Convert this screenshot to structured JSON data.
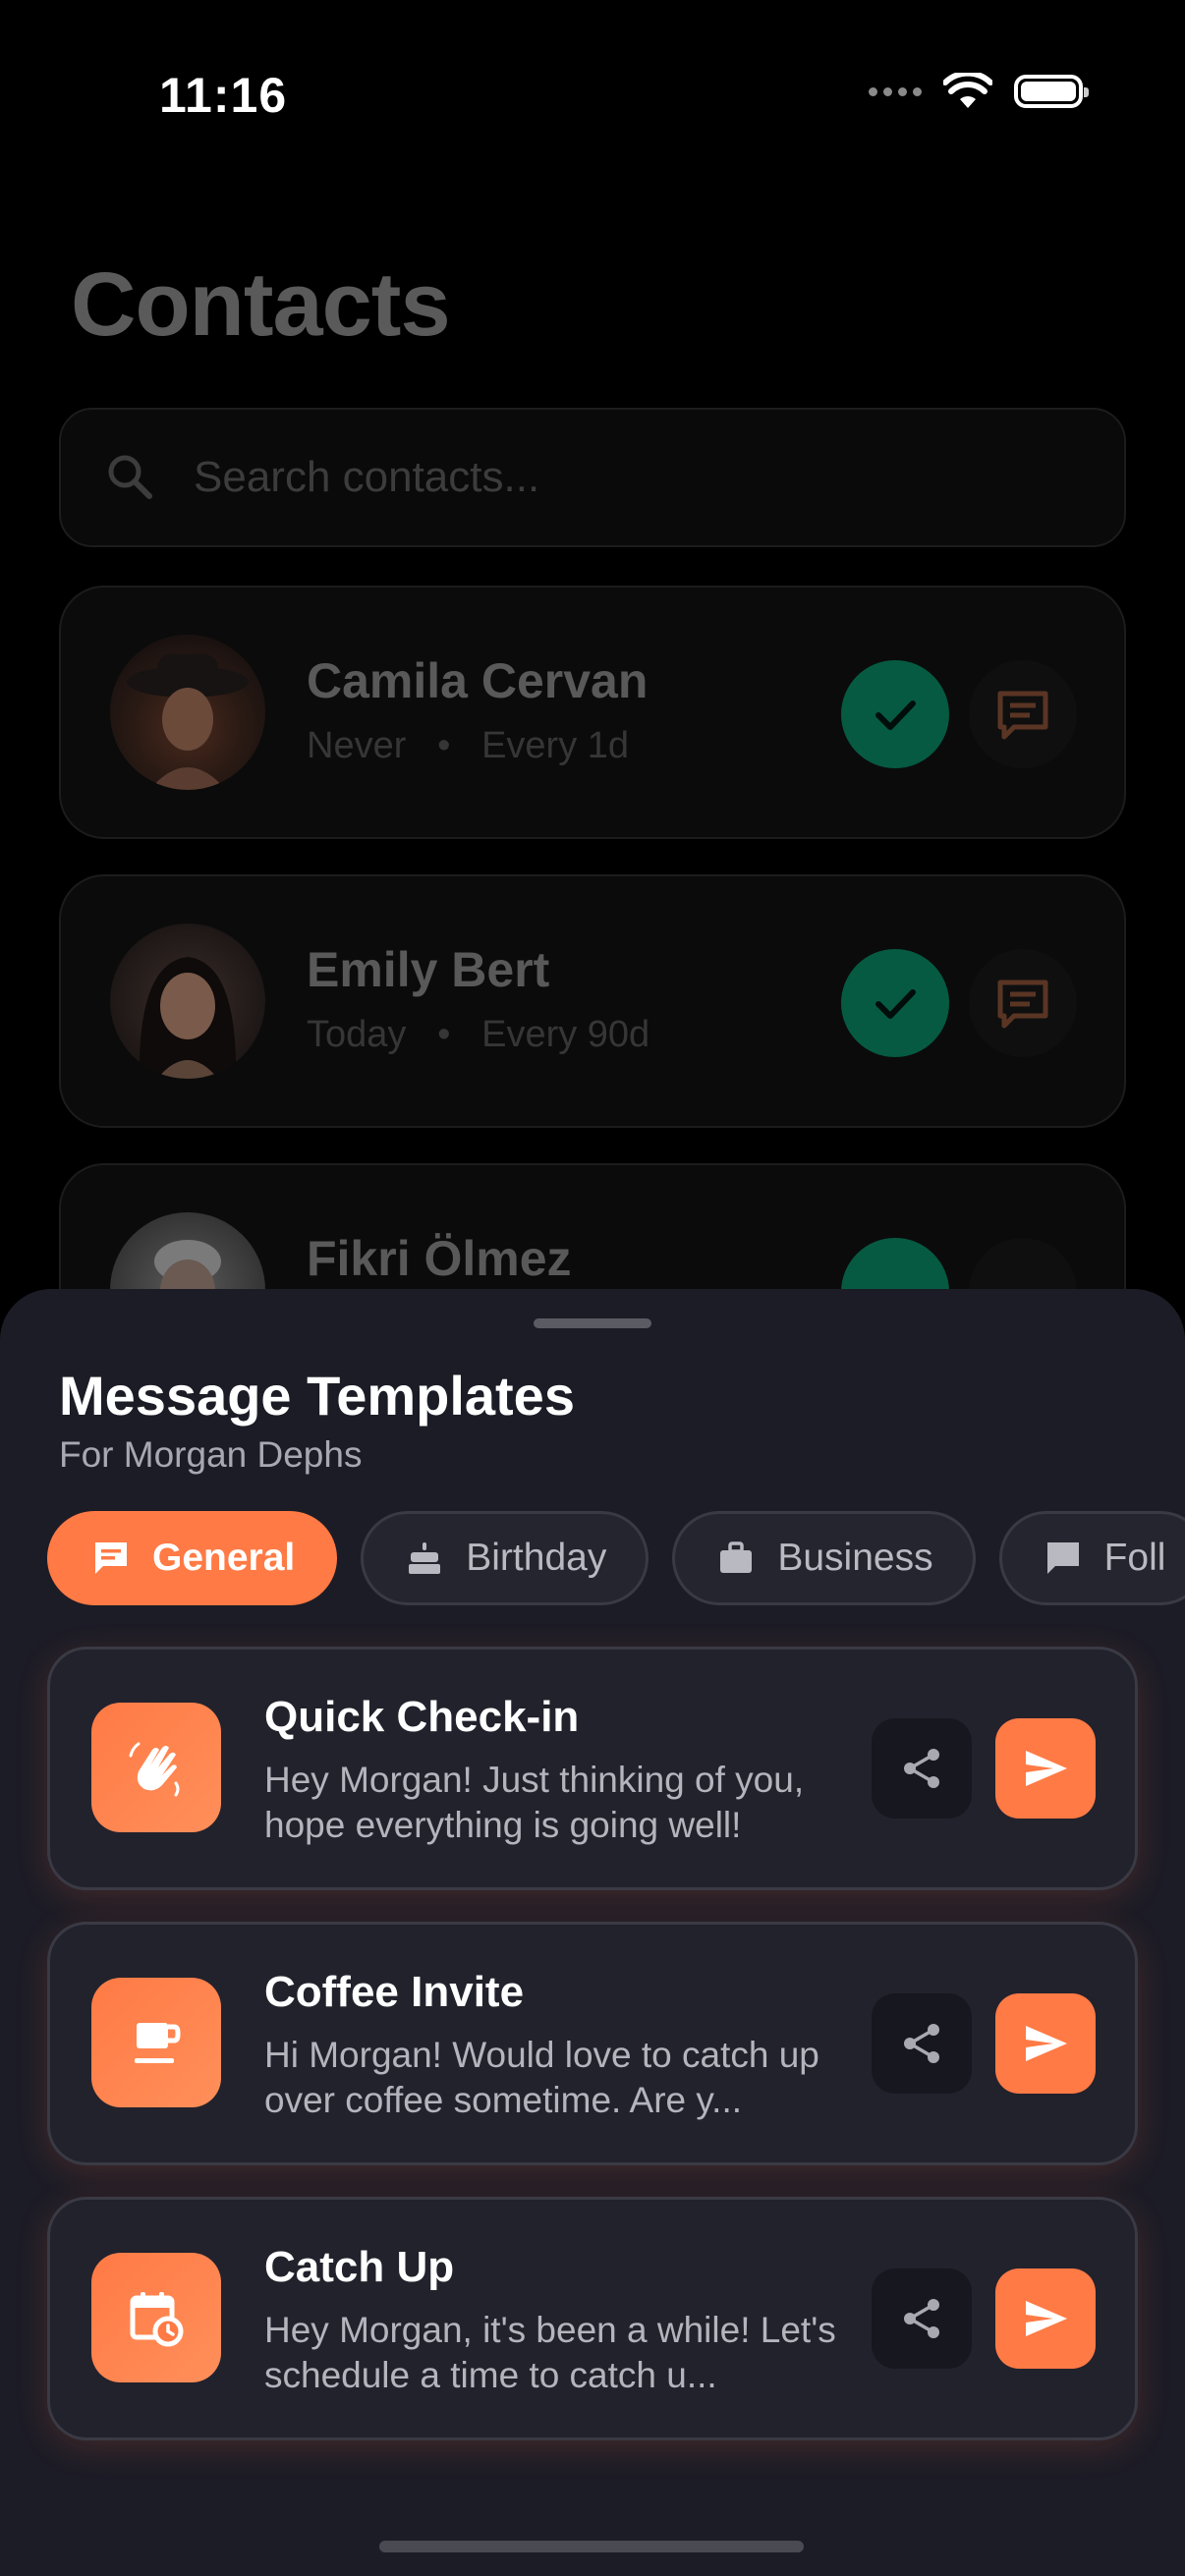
{
  "status_bar": {
    "time": "11:16"
  },
  "page": {
    "title": "Contacts",
    "search": {
      "placeholder": "Search contacts..."
    },
    "contacts": [
      {
        "name": "Camila Cervan",
        "last": "Never",
        "frequency": "Every 1d"
      },
      {
        "name": "Emily Bert",
        "last": "Today",
        "frequency": "Every 90d"
      },
      {
        "name": "Fikri Ölmez",
        "last": "",
        "frequency": ""
      }
    ],
    "meta_separator": "•"
  },
  "sheet": {
    "title": "Message Templates",
    "subtitle": "For Morgan Dephs",
    "categories": [
      {
        "label": "General",
        "icon": "chat-bubble-icon",
        "active": true
      },
      {
        "label": "Birthday",
        "icon": "cake-icon",
        "active": false
      },
      {
        "label": "Business",
        "icon": "briefcase-icon",
        "active": false
      },
      {
        "label": "Foll",
        "icon": "chat-bubble-icon",
        "active": false
      }
    ],
    "templates": [
      {
        "title": "Quick Check-in",
        "body": "Hey Morgan! Just thinking of you, hope everything is going well!",
        "icon": "waving-hand-icon"
      },
      {
        "title": "Coffee Invite",
        "body": "Hi Morgan! Would love to catch up over coffee sometime. Are y...",
        "icon": "coffee-cup-icon"
      },
      {
        "title": "Catch Up",
        "body": "Hey Morgan, it's been a while! Let's schedule a time to catch u...",
        "icon": "calendar-clock-icon"
      }
    ]
  },
  "colors": {
    "accent": "#ff7a45",
    "sheet_bg": "#1c1c26",
    "card_bg": "#22222c",
    "check_green": "#065a42"
  }
}
